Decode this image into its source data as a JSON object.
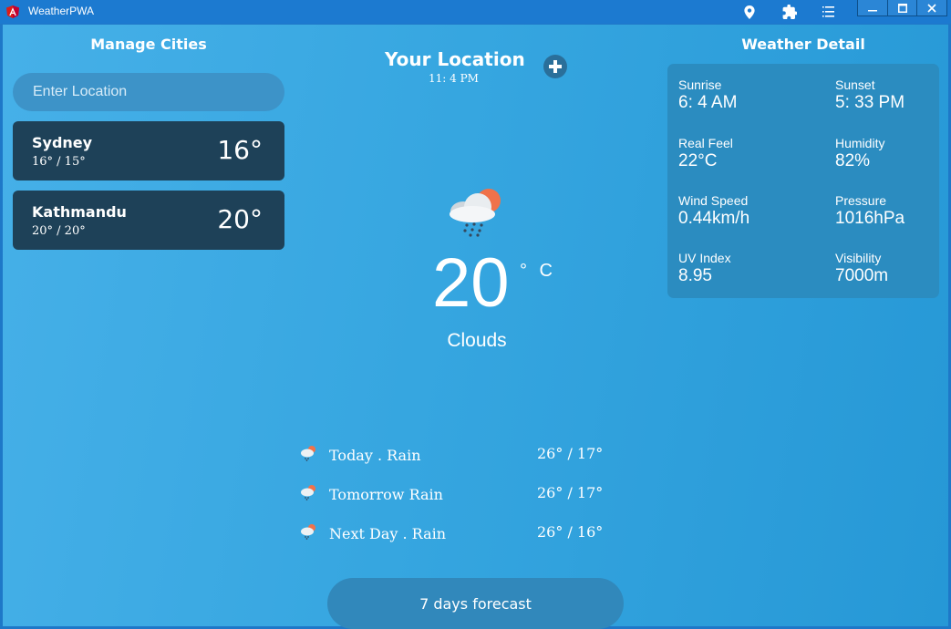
{
  "window": {
    "title": "WeatherPWA",
    "controls": {
      "minimize": "▁",
      "maximize": "☐",
      "close": "✕"
    },
    "toolbar_icons": [
      "location-pin-icon",
      "extension-icon",
      "menu-icon"
    ]
  },
  "left": {
    "title": "Manage Cities",
    "search_placeholder": "Enter Location",
    "cities": [
      {
        "name": "Sydney",
        "range": "16° / 15°",
        "temp": "16°"
      },
      {
        "name": "Kathmandu",
        "range": "20° / 20°",
        "temp": "20°"
      }
    ]
  },
  "center": {
    "title": "Your Location",
    "time": "11: 4 PM",
    "temp": "20",
    "unit": "° C",
    "condition": "Clouds",
    "forecast": [
      {
        "label": "Today . Rain",
        "range": "26° / 17°"
      },
      {
        "label": "Tomorrow Rain",
        "range": "26° / 17°"
      },
      {
        "label": "Next Day . Rain",
        "range": "26° / 16°"
      }
    ],
    "forecast_button": "7 days forecast"
  },
  "right": {
    "title": "Weather Detail",
    "details": [
      {
        "label": "Sunrise",
        "value": "6: 4 AM"
      },
      {
        "label": "Sunset",
        "value": "5: 33 PM"
      },
      {
        "label": "Real Feel",
        "value": "22°C"
      },
      {
        "label": "Humidity",
        "value": "82%"
      },
      {
        "label": "Wind Speed",
        "value": "0.44km/h"
      },
      {
        "label": "Pressure",
        "value": "1016hPa"
      },
      {
        "label": "UV Index",
        "value": "8.95"
      },
      {
        "label": "Visibility",
        "value": "7000m"
      }
    ]
  },
  "colors": {
    "title_bar": "#1c7ad0",
    "city_card": "#1e4158",
    "detail_card": "#2b8cc0",
    "sun": "#f0724a"
  }
}
